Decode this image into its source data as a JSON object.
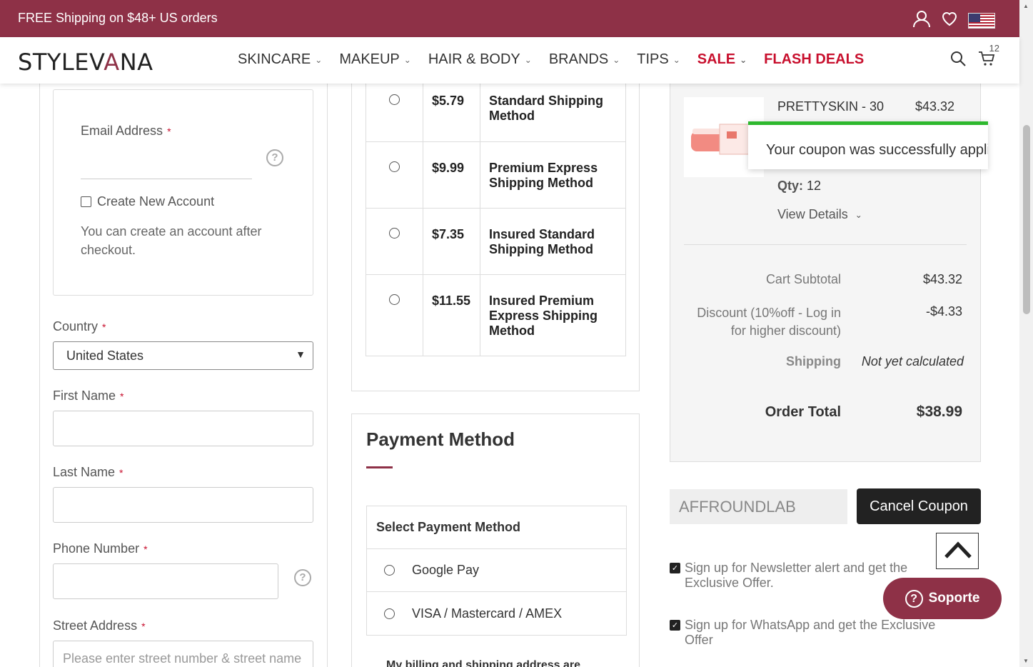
{
  "promo": {
    "text": "FREE Shipping on $48+ US orders"
  },
  "header": {
    "logo_prefix": "STYLEV",
    "logo_accent": "A",
    "logo_suffix": "NA",
    "nav": [
      {
        "label": "SKINCARE"
      },
      {
        "label": "MAKEUP"
      },
      {
        "label": "HAIR & BODY"
      },
      {
        "label": "BRANDS"
      },
      {
        "label": "TIPS"
      },
      {
        "label": "SALE"
      },
      {
        "label": "FLASH DEALS"
      }
    ],
    "cart_count": "12"
  },
  "account": {
    "email_label": "Email Address",
    "req": "*",
    "create_account_label": "Create New Account",
    "create_account_note": "You can create an account after checkout."
  },
  "address": {
    "country_label": "Country",
    "country_value": "United States",
    "first_name_label": "First Name",
    "last_name_label": "Last Name",
    "phone_label": "Phone Number",
    "street_label": "Street Address",
    "street_placeholder": "Please enter street number & street name"
  },
  "shipping": {
    "methods": [
      {
        "price": "$5.79",
        "name": "Standard Shipping Method"
      },
      {
        "price": "$9.99",
        "name": "Premium Express Shipping Method"
      },
      {
        "price": "$7.35",
        "name": "Insured Standard Shipping Method"
      },
      {
        "price": "$11.55",
        "name": "Insured Premium Express Shipping Method"
      }
    ]
  },
  "payment": {
    "title": "Payment Method",
    "select_label": "Select Payment Method",
    "options": [
      {
        "label": "Google Pay"
      },
      {
        "label": "VISA / Mastercard / AMEX"
      }
    ],
    "billing_note": "My billing and shipping address are"
  },
  "summary": {
    "product_name": "PRETTYSKIN - 30",
    "product_price": "$43.32",
    "qty_label": "Qty:",
    "qty_value": "12",
    "view_details": "View Details",
    "toast": "Your coupon was successfully applied",
    "subtotal_label": "Cart Subtotal",
    "subtotal_value": "$43.32",
    "discount_label": "Discount (10%off - Log in for higher discount)",
    "discount_value": "-$4.33",
    "shipping_label": "Shipping",
    "shipping_value": "Not yet calculated",
    "total_label": "Order Total",
    "total_value": "$38.99"
  },
  "coupon": {
    "code": "AFFROUNDLAB",
    "cancel_label": "Cancel Coupon"
  },
  "signups": [
    {
      "label": "Sign up for Newsletter alert and get the Exclusive Offer."
    },
    {
      "label": "Sign up for WhatsApp and get the Exclusive Offer"
    }
  ],
  "support": {
    "label": "Soporte"
  },
  "colors": {
    "brand": "#8e3147",
    "sale": "#c8102e",
    "toast_bar": "#2eb82e"
  }
}
